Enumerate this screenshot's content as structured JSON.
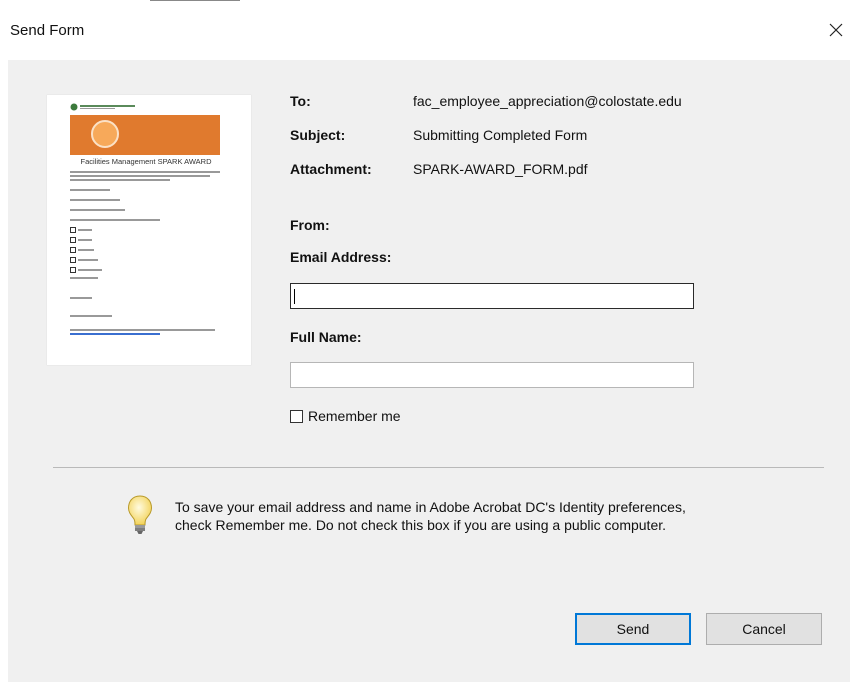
{
  "window": {
    "title": "Send Form"
  },
  "thumbnail": {
    "heading": "Facilities Management SPARK AWARD"
  },
  "fields": {
    "to_label": "To:",
    "to_value": "fac_employee_appreciation@colostate.edu",
    "subject_label": "Subject:",
    "subject_value": "Submitting Completed Form",
    "attachment_label": "Attachment:",
    "attachment_value": "SPARK-AWARD_FORM.pdf",
    "from_label": "From:",
    "email_label": "Email Address:",
    "email_value": "",
    "fullname_label": "Full Name:",
    "fullname_value": ""
  },
  "remember": {
    "label": "Remember me",
    "checked": false
  },
  "info": {
    "text": "To save your email address and name in Adobe Acrobat DC's Identity preferences, check Remember me. Do not check this box if you are using a public computer."
  },
  "buttons": {
    "send": "Send",
    "cancel": "Cancel"
  },
  "colors": {
    "dialog_bg": "#f0f0f0",
    "accent": "#0078d7",
    "banner": "#e07a2e"
  }
}
